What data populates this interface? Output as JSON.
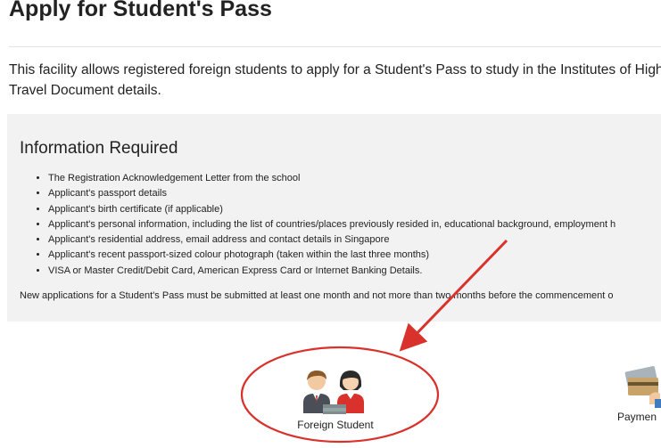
{
  "page": {
    "title": "Apply for Student's Pass",
    "intro_line1": "This facility allows registered foreign students to apply for a Student's Pass to study in the Institutes of Higher",
    "intro_line2": "Travel Document details."
  },
  "info": {
    "heading": "Information Required",
    "items": [
      "The Registration Acknowledgement Letter from the school",
      "Applicant's passport details",
      "Applicant's birth certificate (if applicable)",
      "Applicant's personal information, including the list of countries/places previously resided in, educational background, employment h",
      "Applicant's residential address, email address and contact details in Singapore",
      "Applicant's recent passport-sized colour photograph (taken within the last three months)",
      "VISA or Master Credit/Debit Card, American Express Card or Internet Banking Details."
    ],
    "note": "New applications for a Student's Pass must be submitted at least one month and not more than two months before the commencement o"
  },
  "options": {
    "foreign_student_label": "Foreign Student",
    "payment_label": "Paymen"
  },
  "colors": {
    "annotation": "#d9312b",
    "info_background": "#f2f2f2"
  }
}
